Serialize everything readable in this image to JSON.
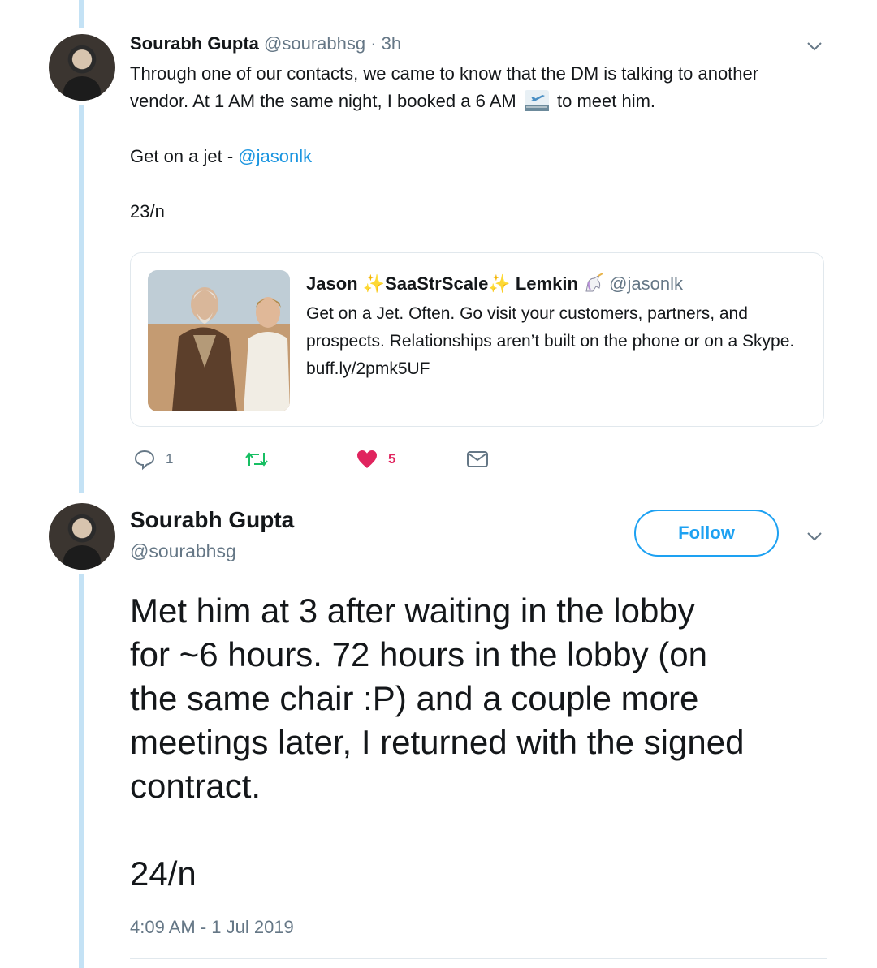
{
  "tweet1": {
    "author_name": "Sourabh Gupta",
    "author_handle": "@sourabhsg",
    "time": "· 3h",
    "body_line1": "Through one of our contacts, we came to know that the DM is talking to another",
    "body_line2a": "vendor. At 1 AM the same night, I booked a 6 AM",
    "body_line2b": "to meet him.",
    "body_para2_prefix": "Get on a jet - ",
    "body_mention": "@jasonlk",
    "thread_index": "23/n",
    "quoted": {
      "name_part1": "Jason",
      "name_part2": "SaaStrScale",
      "name_part3": "Lemkin",
      "handle": "@jasonlk",
      "text": "Get on a Jet. Often. Go visit your customers, partners, and prospects. Relationships aren’t built on the phone or on a Skype. buff.ly/2pmk5UF"
    },
    "actions": {
      "reply_count": "1",
      "retweet_count": "",
      "like_count": "5"
    }
  },
  "tweet2": {
    "author_name": "Sourabh Gupta",
    "author_handle": "@sourabhsg",
    "follow_label": "Follow",
    "body_lines": [
      "Met him at 3 after waiting in the lobby",
      "for ~6 hours. 72 hours in the lobby (on",
      "the same chair :P) and a couple more",
      "meetings later, I returned with the signed",
      "contract."
    ],
    "thread_index": "24/n",
    "timestamp": "4:09 AM - 1 Jul 2019"
  },
  "colors": {
    "accent": "#1da1f2",
    "link": "#1b95e0",
    "like": "#e0245e",
    "muted": "#657786",
    "thread_line": "#c4e2f5"
  }
}
